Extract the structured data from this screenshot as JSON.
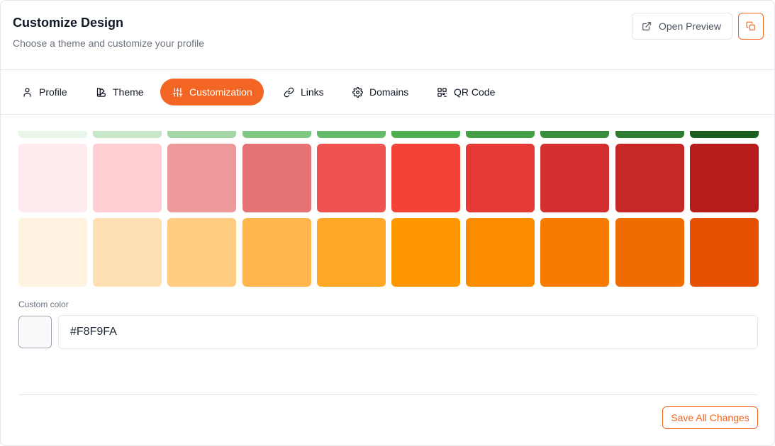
{
  "header": {
    "title": "Customize Design",
    "subtitle": "Choose a theme and customize your profile",
    "open_preview_label": "Open Preview",
    "open_preview_icon": "external-link-icon",
    "copy_icon": "copy-icon"
  },
  "tabs": [
    {
      "label": "Profile",
      "icon": "user-icon",
      "active": false
    },
    {
      "label": "Theme",
      "icon": "palette-icon",
      "active": false
    },
    {
      "label": "Customization",
      "icon": "sliders-icon",
      "active": true
    },
    {
      "label": "Links",
      "icon": "link-icon",
      "active": false
    },
    {
      "label": "Domains",
      "icon": "gear-icon",
      "active": false
    },
    {
      "label": "QR Code",
      "icon": "qr-code-icon",
      "active": false
    }
  ],
  "palette": {
    "rows": [
      [
        "#E8F5E9",
        "#C8E6C9",
        "#A5D6A7",
        "#81C784",
        "#66BB6A",
        "#4CAF50",
        "#43A047",
        "#388E3C",
        "#2E7D32",
        "#1B5E20"
      ],
      [
        "#FFEBEE",
        "#FFCDD2",
        "#EF9A9A",
        "#E57373",
        "#EF5350",
        "#F44336",
        "#E53935",
        "#D32F2F",
        "#C62828",
        "#B71C1C"
      ],
      [
        "#FFF3E0",
        "#FFE0B2",
        "#FFCC80",
        "#FFB74D",
        "#FFA726",
        "#FF9800",
        "#FB8C00",
        "#F57C00",
        "#EF6C00",
        "#E65100"
      ]
    ]
  },
  "custom_color": {
    "label": "Custom color",
    "value": "#F8F9FA"
  },
  "footer": {
    "save_label": "Save All Changes"
  },
  "colors": {
    "accent": "#F26522",
    "border": "#E5E7EB",
    "muted_text": "#6B7280"
  }
}
